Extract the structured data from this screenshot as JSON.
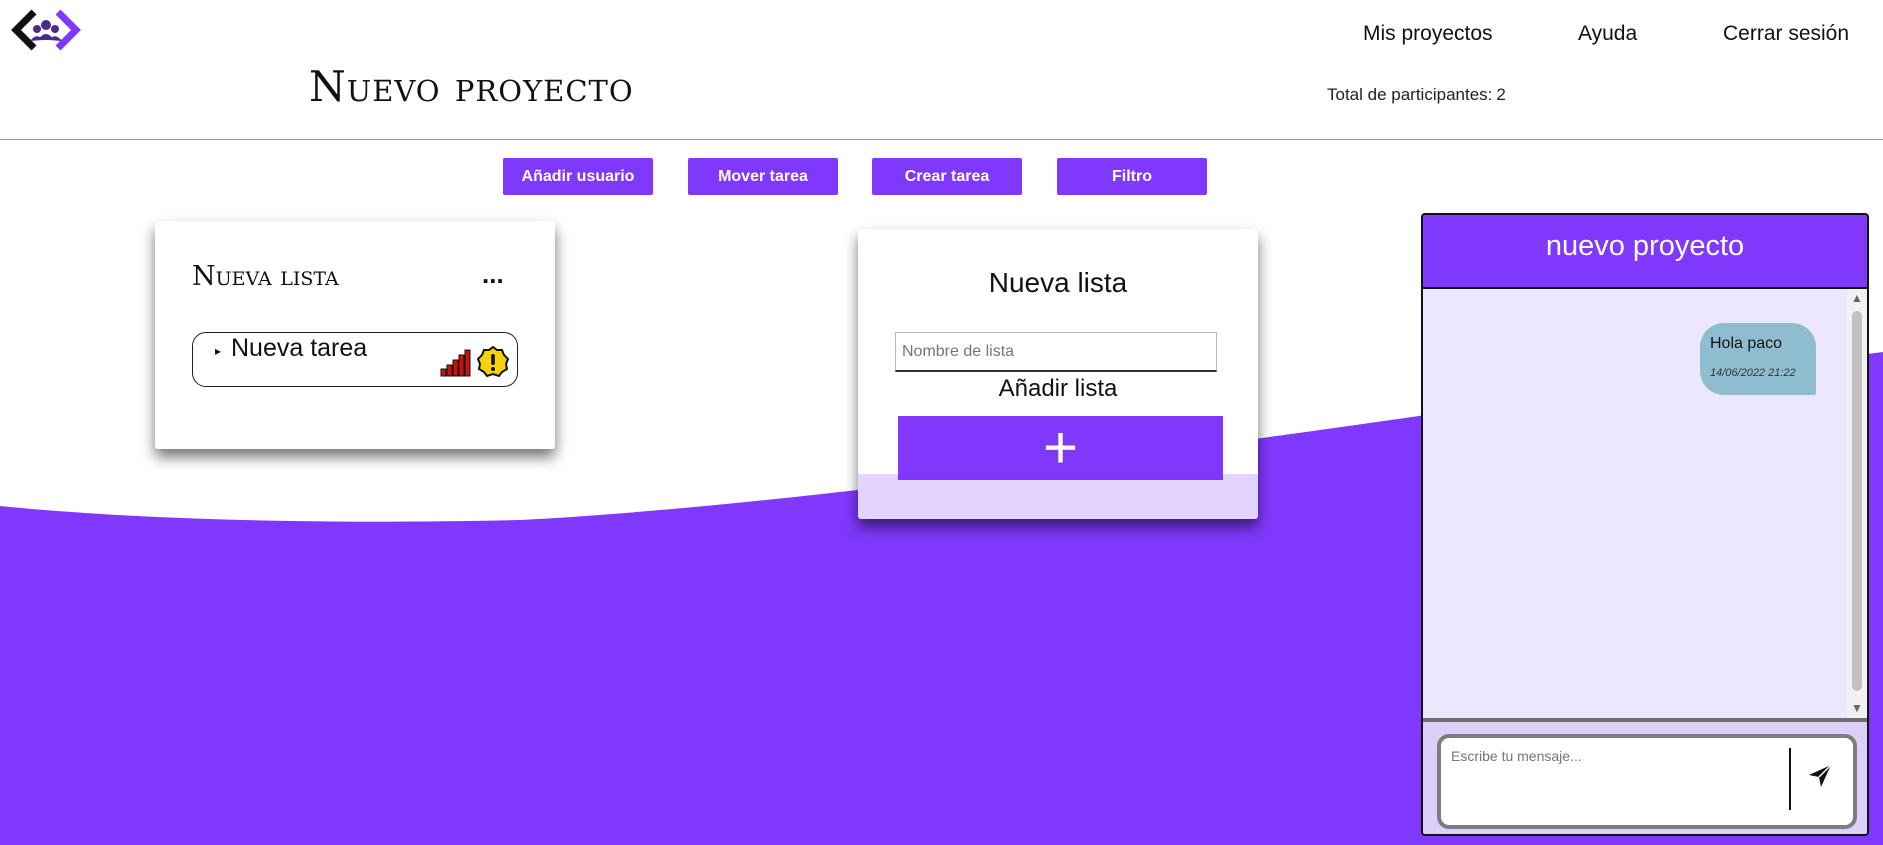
{
  "header": {
    "logo_icon": "group-code-logo-icon",
    "nav": [
      "Mis proyectos",
      "Ayuda",
      "Cerrar sesión"
    ],
    "page_title": "Nuevo proyecto",
    "participants_label": "Total de participantes:",
    "participants_count": "2"
  },
  "toolbar": {
    "add_user": "Añadir usuario",
    "move_task": "Mover tarea",
    "create_task": "Crear tarea",
    "filter": "Filtro"
  },
  "lists": [
    {
      "title": "Nueva lista",
      "menu_label": "...",
      "tasks": [
        {
          "name": "Nueva tarea",
          "icons": [
            "signal-bars-icon",
            "warning-badge-icon"
          ]
        }
      ]
    }
  ],
  "new_list": {
    "title": "Nueva lista",
    "input_placeholder": "Nombre de lista",
    "add_label": "Añadir lista",
    "add_button_icon": "plus-icon"
  },
  "chat": {
    "title": "nuevo proyecto",
    "messages": [
      {
        "text": "Hola paco",
        "timestamp": "14/06/2022 21:22"
      }
    ],
    "input_placeholder": "Escribe tu mensaje...",
    "send_icon": "send-icon"
  },
  "colors": {
    "accent": "#8138fd",
    "chat_bubble": "#8fbdd0",
    "chat_background": "#ede7fd"
  }
}
